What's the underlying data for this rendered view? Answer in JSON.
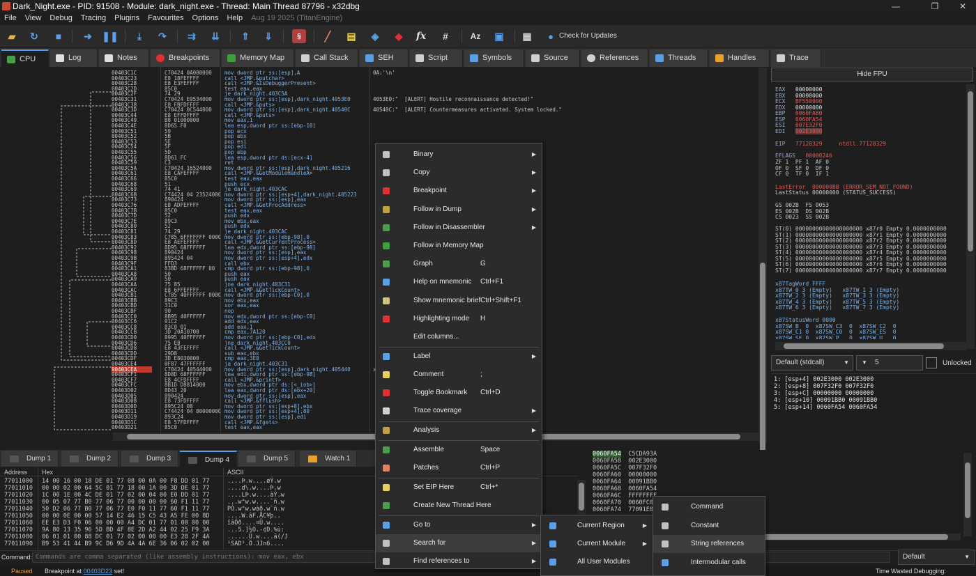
{
  "window": {
    "title": "Dark_Night.exe - PID: 91508 - Module: dark_night.exe - Thread: Main Thread 87796 - x32dbg",
    "min": "—",
    "max": "❐",
    "close": "✕"
  },
  "menu": {
    "items": [
      "File",
      "View",
      "Debug",
      "Tracing",
      "Plugins",
      "Favourites",
      "Options",
      "Help"
    ],
    "date": "Aug 19 2025 (TitanEngine)"
  },
  "toolbar": {
    "check_updates": "Check for Updates"
  },
  "tabs": [
    {
      "label": "CPU",
      "color": "#4a9d4a"
    },
    {
      "label": "Log",
      "color": "#e0e0e0"
    },
    {
      "label": "Notes",
      "color": "#e0e0e0"
    },
    {
      "label": "Breakpoints",
      "color": "#e03030"
    },
    {
      "label": "Memory Map",
      "color": "#3da03d"
    },
    {
      "label": "Call Stack",
      "color": "#d0d0d0"
    },
    {
      "label": "SEH",
      "color": "#5aa0e8"
    },
    {
      "label": "Script",
      "color": "#d0d0d0"
    },
    {
      "label": "Symbols",
      "color": "#5aa0e8"
    },
    {
      "label": "Source",
      "color": "#d0d0d0"
    },
    {
      "label": "References",
      "color": "#d0d0d0"
    },
    {
      "label": "Threads",
      "color": "#5aa0e8"
    },
    {
      "label": "Handles",
      "color": "#e8a030"
    },
    {
      "label": "Trace",
      "color": "#d0d0d0"
    }
  ],
  "disasm": {
    "rows": [
      [
        "00403C1C",
        "C70424 0A000000",
        "mov dword ptr ss:[esp],A",
        "0A:'\\n'"
      ],
      [
        "00403C23",
        "E8 18FEFFFF",
        "call <JMP.&putchar>",
        ""
      ],
      [
        "00403C28",
        "E8 E3FEFFFF",
        "call <JMP.&IsDebuggerPresent>",
        ""
      ],
      [
        "00403C2D",
        "85C0",
        "test eax,eax",
        ""
      ],
      [
        "00403C2F",
        "74 29",
        "je dark_night.403C5A",
        ""
      ],
      [
        "00403C31",
        "C70424 E0534000",
        "mov dword ptr ss:[esp],dark_night.4053E0",
        "4053E0:\"  [ALERT] Hostile reconnaissance detected!\""
      ],
      [
        "00403C38",
        "E8 FBFDFFFF",
        "call <JMP.&puts>",
        ""
      ],
      [
        "00403C3D",
        "C70424 0C544000",
        "mov dword ptr ss:[esp],dark_night.40540C",
        "40540C:\"  [ALERT] Countermeasures activated. System locked.\""
      ],
      [
        "00403C44",
        "E8 EFFDFFFF",
        "call <JMP.&puts>",
        ""
      ],
      [
        "00403C49",
        "B8 01000000",
        "mov eax,1",
        ""
      ],
      [
        "00403C4E",
        "8D65 F0",
        "lea esp,dword ptr ss:[ebp-10]",
        ""
      ],
      [
        "00403C51",
        "59",
        "pop ecx",
        ""
      ],
      [
        "00403C52",
        "5B",
        "pop ebx",
        ""
      ],
      [
        "00403C53",
        "5E",
        "pop esi",
        ""
      ],
      [
        "00403C54",
        "5F",
        "pop edi",
        ""
      ],
      [
        "00403C55",
        "5D",
        "pop ebp",
        ""
      ],
      [
        "00403C56",
        "8D61 FC",
        "lea esp,dword ptr ds:[ecx-4]",
        ""
      ],
      [
        "00403C59",
        "C3",
        "ret",
        ""
      ],
      [
        "00403C5A",
        "C70424 16524000",
        "mov dword ptr ss:[esp],dark_night.405216",
        ""
      ],
      [
        "00403C61",
        "E8 CAFEFFFF",
        "call <JMP.&GetModuleHandleA>",
        ""
      ],
      [
        "00403C66",
        "85C0",
        "test eax,eax",
        ""
      ],
      [
        "00403C68",
        "51",
        "push ecx",
        ""
      ],
      [
        "00403C69",
        "74 41",
        "je dark_night.403CAC",
        ""
      ],
      [
        "00403C6B",
        "C74424 04 23524000",
        "mov dword ptr ss:[esp+4],dark_night.405223",
        ""
      ],
      [
        "00403C73",
        "890424",
        "mov dword ptr ss:[esp],eax",
        ""
      ],
      [
        "00403C76",
        "E8 ADFEFFFF",
        "call <JMP.&GetProcAddress>",
        ""
      ],
      [
        "00403C7B",
        "85C0",
        "test eax,eax",
        ""
      ],
      [
        "00403C7D",
        "52",
        "push edx",
        ""
      ],
      [
        "00403C7E",
        "89C3",
        "mov ebx,eax",
        ""
      ],
      [
        "00403C80",
        "52",
        "push edx",
        ""
      ],
      [
        "00403C81",
        "74 29",
        "je dark_night.403CAC",
        ""
      ],
      [
        "00403C83",
        "C785 6FFFFFFF 0000",
        "mov dword ptr ss:[ebp-98],0",
        ""
      ],
      [
        "00403C8D",
        "E8 AEFEFFFF",
        "call <JMP.&GetCurrentProcess>",
        ""
      ],
      [
        "00403C92",
        "8D95 68FFFFFF",
        "lea edx,dword ptr ss:[ebp-98]",
        ""
      ],
      [
        "00403C98",
        "890424",
        "mov dword ptr ss:[esp],eax",
        ""
      ],
      [
        "00403C9B",
        "895424 04",
        "mov dword ptr ss:[esp+4],edx",
        ""
      ],
      [
        "00403C9F",
        "FFD3",
        "call ebx",
        ""
      ],
      [
        "00403CA1",
        "83BD 68FFFFFF 00",
        "cmp dword ptr ss:[ebp-98],0",
        ""
      ],
      [
        "00403CA8",
        "50",
        "push eax",
        ""
      ],
      [
        "00403CA9",
        "50",
        "push eax",
        ""
      ],
      [
        "00403CAA",
        "75 85",
        "jne dark_night.403C31",
        ""
      ],
      [
        "00403CAC",
        "E8 6FFEFFFF",
        "call <JMP.&GetTickCount>",
        ""
      ],
      [
        "00403CB1",
        "C785 40FFFFFF 0000",
        "mov dword ptr ss:[ebp-C0],0",
        ""
      ],
      [
        "00403CBB",
        "89C3",
        "mov ebx,eax",
        ""
      ],
      [
        "00403CBD",
        "31C0",
        "xor eax,eax",
        ""
      ],
      [
        "00403CBF",
        "90",
        "nop",
        ""
      ],
      [
        "00403CC0",
        "8B95 40FFFFFF",
        "mov edx,dword ptr ss:[ebp-C0]",
        ""
      ],
      [
        "00403CC6",
        "01C2",
        "add edx,eax",
        ""
      ],
      [
        "00403CC8",
        "83C0 01",
        "add eax,1",
        ""
      ],
      [
        "00403CCB",
        "3D 20A10700",
        "cmp eax,7A120",
        ""
      ],
      [
        "00403CD0",
        "8995 40FFFFFF",
        "mov dword ptr ss:[ebp-C0],edx",
        ""
      ],
      [
        "00403CD6",
        "75 E8",
        "jne dark_night.403CC0",
        ""
      ],
      [
        "00403CD8",
        "E8 43FEFFFF",
        "call <JMP.&GetTickCount>",
        ""
      ],
      [
        "00403CDD",
        "29D8",
        "sub eax,ebx",
        ""
      ],
      [
        "00403CDF",
        "3D E8030000",
        "cmp eax,3E8",
        ""
      ],
      [
        "00403CE4",
        "0F87 47FFFFFF",
        "ja dark_night.403C31",
        ""
      ],
      [
        "00403CEA",
        "C70424 40544000",
        "mov dword ptr ss:[esp],dark_night.405440",
        "xx): \""
      ],
      [
        "00403CF1",
        "8D8D 68FFFFFF",
        "lea edi,dword ptr ss:[ebp-98]",
        ""
      ],
      [
        "00403CF7",
        "E8 4CFDFFFF",
        "call <JMP.&printf>",
        ""
      ],
      [
        "00403CFC",
        "8B1D D8814000",
        "mov ebx,dword ptr ds:[<_iob>]",
        ""
      ],
      [
        "00403D02",
        "8D43 20",
        "lea eax,dword ptr ds:[ebx+20]",
        ""
      ],
      [
        "00403D05",
        "890424",
        "mov dword ptr ss:[esp],eax",
        ""
      ],
      [
        "00403D08",
        "E8 73FDFFFF",
        "call <JMP.&fflush>",
        ""
      ],
      [
        "00403D0D",
        "895C24 08",
        "mov dword ptr ss:[esp+8],ebx",
        ""
      ],
      [
        "00403D11",
        "C74424 04 80000000",
        "mov dword ptr ss:[esp+4],80",
        ""
      ],
      [
        "00403D19",
        "893C24",
        "mov dword ptr ss:[esp],edi",
        ""
      ],
      [
        "00403D1C",
        "E8 57FDFFFF",
        "call <JMP.&fgets>",
        ""
      ],
      [
        "00403D21",
        "85C0",
        "test eax,eax",
        ""
      ]
    ],
    "highlight": "00403CEA"
  },
  "fpu": {
    "hide_label": "Hide FPU"
  },
  "registers": [
    [
      "EAX",
      "00000000",
      false
    ],
    [
      "EBX",
      "00000000",
      false
    ],
    [
      "ECX",
      "BF550000",
      true
    ],
    [
      "EDX",
      "00000000",
      false
    ],
    [
      "EBP",
      "0060FA80",
      true
    ],
    [
      "ESP",
      "0060FA54",
      true
    ],
    [
      "ESI",
      "007E32F0",
      true
    ],
    [
      "EDI",
      "002E3000",
      true
    ]
  ],
  "eip": {
    "name": "EIP",
    "value": "77128329",
    "sym": "ntdll.77128329"
  },
  "eflags": {
    "label": "EFLAGS",
    "value": "00000246",
    "l1": "ZF 1  PF 1  AF 0",
    "l2": "OF 0  SF 0  DF 0",
    "l3": "CF 0  TF 0  IF 1"
  },
  "lasterr": {
    "l1": "LastError  000000BB (ERROR_SEM_NOT_FOUND)",
    "l2": "LastStatus 00000000 (STATUS_SUCCESS)"
  },
  "segs": [
    "GS 002B  FS 0053",
    "ES 002B  DS 002B",
    "CS 0023  SS 002B"
  ],
  "st": [
    "ST(0) 00000000000000000000 x87r0 Empty 0.0000000000",
    "ST(1) 00000000000000000000 x87r1 Empty 0.0000000000",
    "ST(2) 00000000000000000000 x87r2 Empty 0.0000000000",
    "ST(3) 00000000000000000000 x87r3 Empty 0.0000000000",
    "ST(4) 00000000000000000000 x87r4 Empty 0.0000000000",
    "ST(5) 00000000000000000000 x87r5 Empty 0.0000000000",
    "ST(6) 00000000000000000000 x87r6 Empty 0.0000000000",
    "ST(7) 00000000000000000000 x87r7 Empty 0.0000000000"
  ],
  "tag": [
    "x87TagWord FFFF",
    "x87TW_0 3 (Empty)   x87TW_1 3 (Empty)",
    "x87TW_2 3 (Empty)   x87TW_3 3 (Empty)",
    "x87TW_4 3 (Empty)   x87TW_5 3 (Empty)",
    "x87TW_6 3 (Empty)   x87TW_7 3 (Empty)"
  ],
  "sw": [
    "x87StatusWord 0000",
    "x87SW_B  0  x87SW_C3  0  x87SW_C2  0",
    "x87SW_C1 0  x87SW_C0  0  x87SW_ES  0",
    "x87SW_SF 0  x87SW_P   0  x87SW_U   0"
  ],
  "callconv": {
    "selected": "Default (stdcall)",
    "count": "5",
    "unlocked": "Unlocked"
  },
  "callstack": [
    "1: [esp+4] 002E3000 002E3000",
    "2: [esp+8] 007F32F0 007F32F0",
    "3: [esp+C] 00000000 00000000",
    "4: [esp+10] 00091BB0 00091BB0",
    "5: [esp+14] 0060FA54 0060FA54"
  ],
  "dumptabs": [
    "Dump 1",
    "Dump 2",
    "Dump 3",
    "Dump 4",
    "Dump 5",
    "Watch 1"
  ],
  "dump": {
    "headers": [
      "Address",
      "Hex",
      "ASCII"
    ],
    "rows": [
      [
        "77011000",
        "14 00 16 00 18 DE 01 77 08 00 0A 00 F8 DD 01 77",
        "....Þ.w....øÝ.w"
      ],
      [
        "77011010",
        "00 00 02 00 64 5C 01 77 18 00 1A 00 3D DE 01 77",
        "....d\\.w....Þ.w"
      ],
      [
        "77011020",
        "1C 00 1E 00 4C DE 01 77 02 00 04 00 E0 DD 01 77",
        "....LÞ.w....àÝ.w"
      ],
      [
        "77011030",
        "00 05 07 77 B0 77 06 77 00 00 00 00 60 F1 11 77",
        "...w°w.w....`ñ.w"
      ],
      [
        "77011040",
        "50 D2 06 77 B0 77 06 77 E0 F0 11 77 60 F1 11 77",
        "PÒ.w°w.wàð.w`ñ.w"
      ],
      [
        "77011050",
        "00 00 0E 00 00 57 14 E2 46 15 C5 43 A5 FE 00 8D",
        "....W.âF.ÅC¥þ.."
      ],
      [
        "77011060",
        "EE E3 D3 F0 06 00 00 00 A4 DC 01 77 01 00 00 00",
        "îãÓð....¤Ü.w...."
      ],
      [
        "77011070",
        "9A 80 13 35 96 5D BD 4F 8E 2D A2 44 02 25 F9 3A",
        "...5.]½O.-¢D.%ù:"
      ],
      [
        "77011080",
        "06 01 01 00 88 DC 01 77 02 00 00 00 E3 28 2F 4A",
        "......Ü.w....ã(/J"
      ],
      [
        "77011090",
        "B9 53 41 44 B9 9C D6 9D 4A 4A 6E 36 06 02 02 00",
        "¹SAD¹.Ö.JJn6...."
      ]
    ]
  },
  "stack": [
    [
      "0060FA54",
      "C5CDA93A"
    ],
    [
      "0060FA58",
      "002E3000"
    ],
    [
      "0060FA5C",
      "007F32F0"
    ],
    [
      "0060FA60",
      "00000000"
    ],
    [
      "0060FA64",
      "00091BB0"
    ],
    [
      "0060FA68",
      "0060FA54"
    ],
    [
      "0060FA6C",
      "FFFFFFFF"
    ],
    [
      "0060FA70",
      "0060FC00"
    ],
    [
      "0060FA74",
      "77091E0"
    ]
  ],
  "command": {
    "label": "Command:",
    "placeholder": "Commands are comma separated (like assembly instructions): mov eax, ebx",
    "mode": "Default"
  },
  "status": {
    "state": "Paused",
    "bp_prefix": "Breakpoint at",
    "bp_addr": "00403D23",
    "bp_suffix": "set!",
    "time": "Time Wasted Debugging: 0:04:51:25"
  },
  "context_menu": {
    "items": [
      {
        "label": "Binary",
        "sc": "",
        "sub": true,
        "color": "#c0c0c0"
      },
      {
        "label": "Copy",
        "sc": "",
        "sub": true,
        "color": "#c0c0c0"
      },
      {
        "label": "Breakpoint",
        "sc": "",
        "sub": true,
        "color": "#e03030"
      },
      {
        "label": "Follow in Dump",
        "sc": "",
        "sub": true,
        "color": "#c0a040"
      },
      {
        "label": "Follow in Disassembler",
        "sc": "",
        "sub": true,
        "color": "#4a9d4a"
      },
      {
        "label": "Follow in Memory Map",
        "sc": "",
        "sub": false,
        "color": "#3da03d"
      },
      {
        "label": "Graph",
        "sc": "G",
        "sub": false,
        "color": "#4a9d4a"
      },
      {
        "label": "Help on mnemonic",
        "sc": "Ctrl+F1",
        "sub": false,
        "color": "#5aa0e8"
      },
      {
        "label": "Show mnemonic brief",
        "sc": "Ctrl+Shift+F1",
        "sub": false,
        "color": "#d0c080"
      },
      {
        "label": "Highlighting mode",
        "sc": "H",
        "sub": false,
        "color": "#e03030"
      },
      {
        "label": "Edit columns...",
        "sc": "",
        "sub": false,
        "color": ""
      },
      {
        "label": "Label",
        "sc": "",
        "sub": true,
        "color": "#5aa0e8"
      },
      {
        "label": "Comment",
        "sc": ";",
        "sub": false,
        "color": "#e8d060"
      },
      {
        "label": "Toggle Bookmark",
        "sc": "Ctrl+D",
        "sub": false,
        "color": "#e03030"
      },
      {
        "label": "Trace coverage",
        "sc": "",
        "sub": true,
        "color": "#d0d0d0"
      },
      {
        "label": "Analysis",
        "sc": "",
        "sub": true,
        "color": "#c0a040"
      },
      {
        "label": "Assemble",
        "sc": "Space",
        "sub": false,
        "color": "#4a9d4a"
      },
      {
        "label": "Patches",
        "sc": "Ctrl+P",
        "sub": false,
        "color": "#e08060"
      },
      {
        "label": "Set EIP Here",
        "sc": "Ctrl+*",
        "sub": false,
        "color": "#e8d060"
      },
      {
        "label": "Create New Thread Here",
        "sc": "",
        "sub": false,
        "color": "#4a9d4a"
      },
      {
        "label": "Go to",
        "sc": "",
        "sub": true,
        "color": "#5aa0e8"
      },
      {
        "label": "Search for",
        "sc": "",
        "sub": true,
        "color": "#c0c0c0"
      },
      {
        "label": "Find references to",
        "sc": "",
        "sub": true,
        "color": "#c0c0c0"
      }
    ]
  },
  "submenu1": [
    "Current Region",
    "Current Module",
    "All User Modules"
  ],
  "submenu2": [
    "Command",
    "Constant",
    "String references",
    "Intermodular calls"
  ]
}
